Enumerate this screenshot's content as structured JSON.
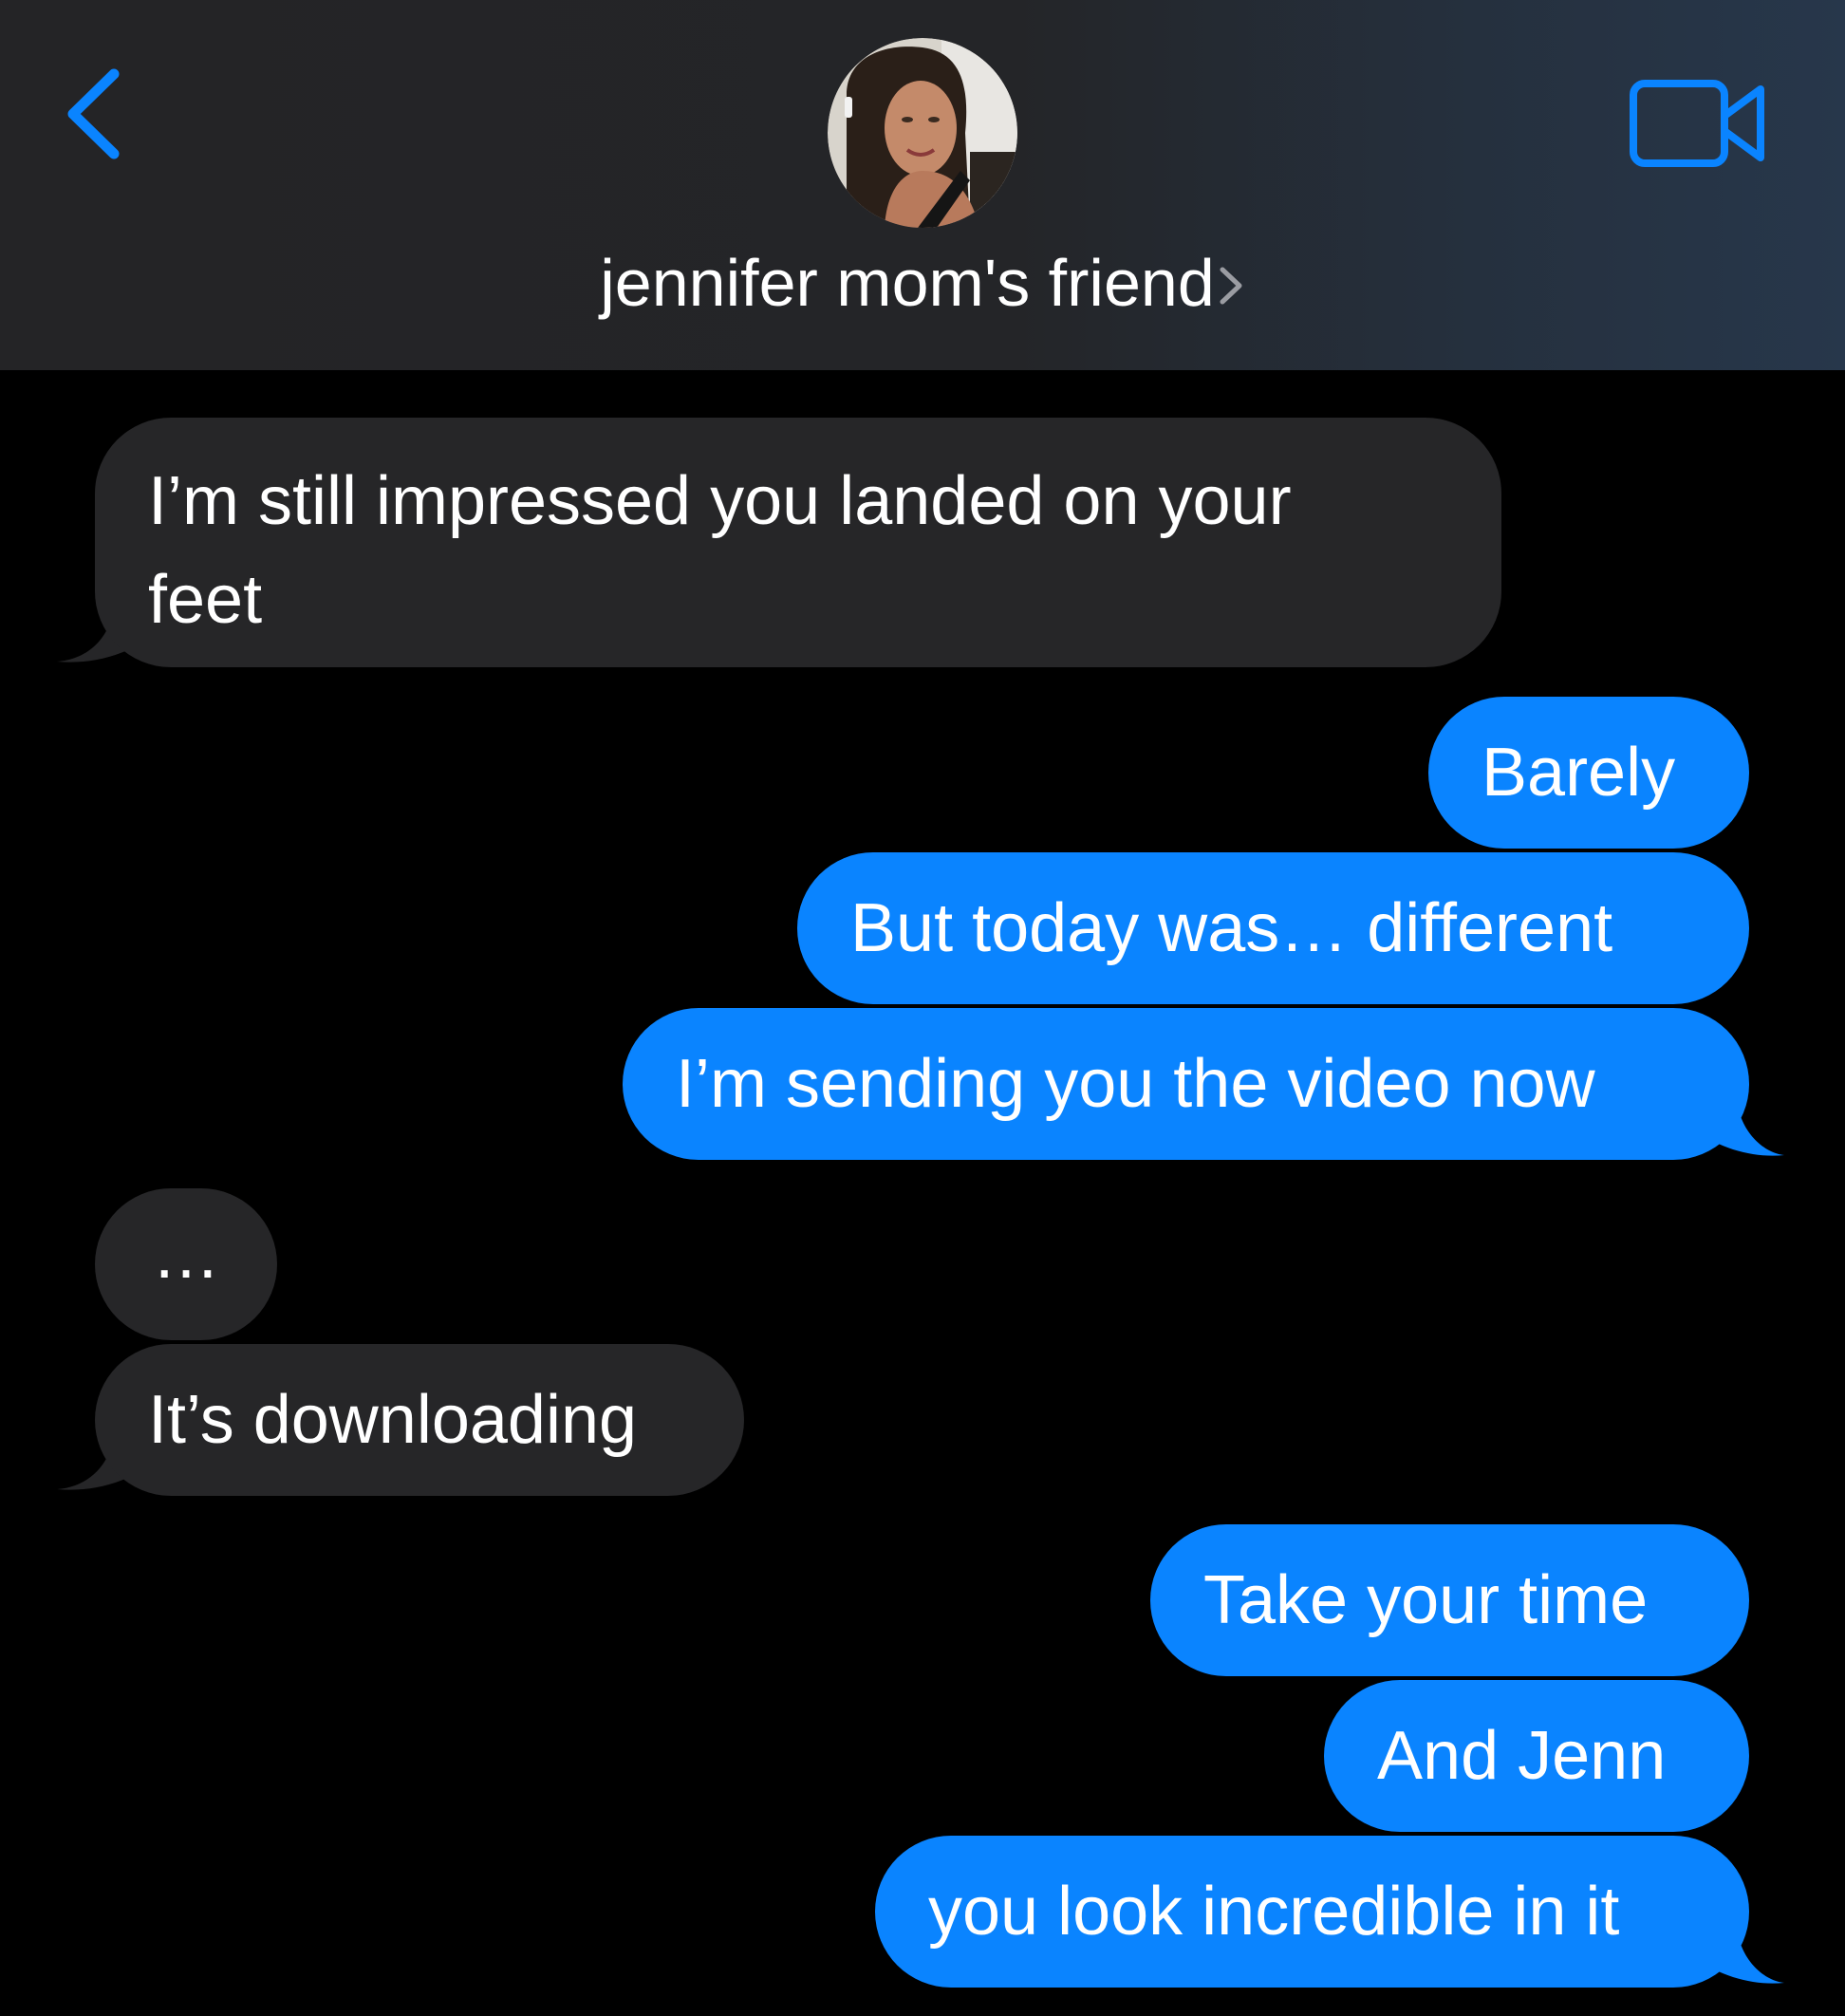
{
  "header": {
    "contact_name": "jennifer mom's friend",
    "accent_color": "#0a84ff",
    "back_icon": "chevron-left-icon",
    "video_icon": "video-camera-icon",
    "avatar_icon": "contact-photo"
  },
  "messages": [
    {
      "direction": "incoming",
      "text_lines": [
        "I’m still impressed you landed on your",
        "feet"
      ]
    },
    {
      "direction": "outgoing",
      "text": "Barely"
    },
    {
      "direction": "outgoing",
      "text": "But today was… different"
    },
    {
      "direction": "outgoing",
      "text": "I’m sending you the video now"
    },
    {
      "direction": "incoming",
      "text": "…"
    },
    {
      "direction": "incoming",
      "text": "It’s downloading"
    },
    {
      "direction": "outgoing",
      "text": "Take your time"
    },
    {
      "direction": "outgoing",
      "text": "And Jenn"
    },
    {
      "direction": "outgoing",
      "text": "you look incredible in it"
    }
  ],
  "colors": {
    "incoming_bubble": "#262628",
    "outgoing_bubble": "#0a84ff",
    "background": "#000000",
    "header_background": "#242426"
  }
}
